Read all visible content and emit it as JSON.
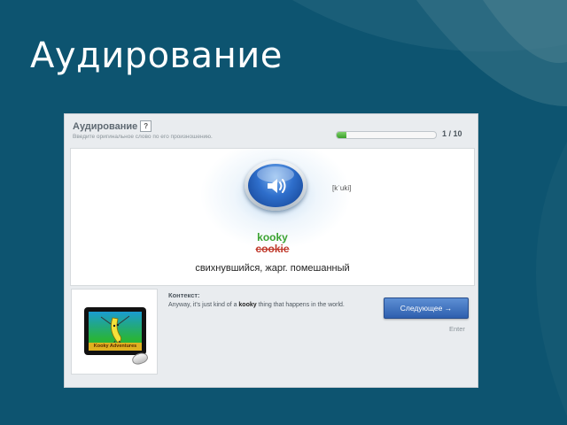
{
  "slide": {
    "title": "Аудирование"
  },
  "exercise": {
    "title": "Аудирование",
    "help_label": "?",
    "subtitle": "Введите оригинальное слово по его произношению.",
    "progress": {
      "current": 1,
      "total": 10,
      "label": "1 / 10",
      "fraction": 0.1
    },
    "transcription": "[kˈuki]",
    "correct_word": "kooky",
    "wrong_word": "cookie",
    "translation": "свихнувшийся, жарг. помешанный",
    "context": {
      "label": "Контекст:",
      "text_before": "Anyway, it's just kind of a ",
      "highlight": "kooky",
      "text_after": " thing that happens in the world."
    },
    "thumbnail_caption": "Kooky Adventures",
    "next_button_label": "Следующее →",
    "enter_hint": "Enter"
  },
  "colors": {
    "background": "#0d5470",
    "correct": "#3aa332",
    "wrong": "#c0392b",
    "button": "#3a6fbf"
  },
  "icons": [
    "speaker-icon",
    "help-icon",
    "mouse-icon"
  ]
}
